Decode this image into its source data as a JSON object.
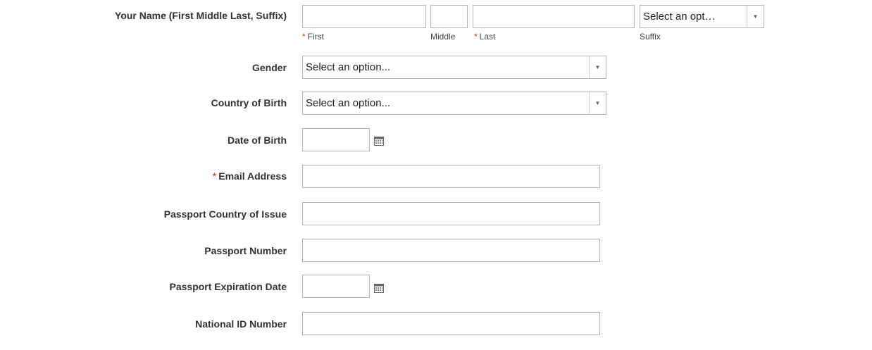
{
  "name_row": {
    "label": "Your Name (First Middle Last, Suffix)",
    "first": {
      "value": "",
      "sublabel": "First",
      "required": "*"
    },
    "middle": {
      "value": "",
      "sublabel": "Middle"
    },
    "last": {
      "value": "",
      "sublabel": "Last",
      "required": "*"
    },
    "suffix": {
      "selected": "Select an opt…",
      "sublabel": "Suffix"
    }
  },
  "gender": {
    "label": "Gender",
    "selected": "Select an option..."
  },
  "country_of_birth": {
    "label": "Country of Birth",
    "selected": "Select an option..."
  },
  "date_of_birth": {
    "label": "Date of Birth",
    "value": "",
    "icon": "calendar-icon"
  },
  "email": {
    "label": "Email Address",
    "required": "*",
    "value": ""
  },
  "passport_country": {
    "label": "Passport Country of Issue",
    "value": ""
  },
  "passport_number": {
    "label": "Passport Number",
    "value": ""
  },
  "passport_expiration": {
    "label": "Passport Expiration Date",
    "value": "",
    "icon": "calendar-icon"
  },
  "national_id": {
    "label": "National ID Number",
    "value": ""
  },
  "colors": {
    "required": "#c0392b",
    "border": "#b5b5b5"
  }
}
